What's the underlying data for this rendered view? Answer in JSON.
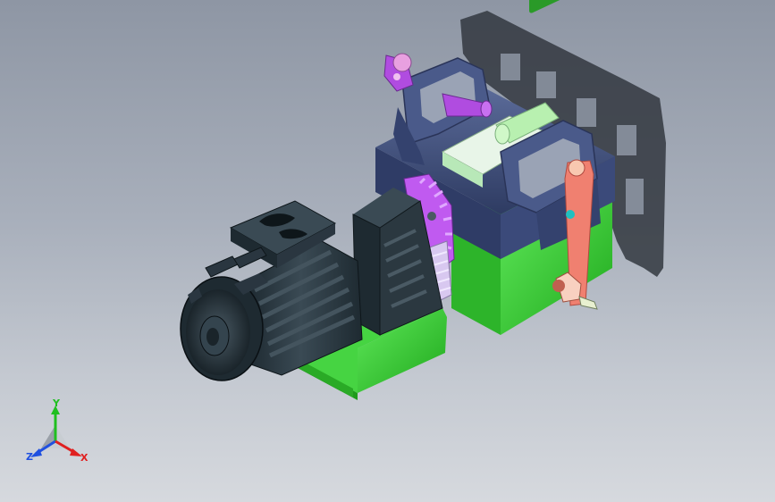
{
  "viewport": {
    "background_top": "#8e96a4",
    "background_bottom": "#d6d9de"
  },
  "model": {
    "parts": {
      "motor": "#2d3a42",
      "motor_housing": "#25323a",
      "gearbox": "#2b3840",
      "gear": "#c05af0",
      "rack": "#d8c8f0",
      "base_green": "#3fd23a",
      "frame_navy": "#3e4d7a",
      "purple_pin": "#b04ce0",
      "light_green_roller": "#b8f0b0",
      "salmon_lever": "#f08070",
      "shadow": "#3a3f48"
    }
  },
  "triad": {
    "y_label": "Y",
    "z_label": "Z",
    "x_label": "X",
    "y_color": "#1fbf1f",
    "z_color": "#2050e0",
    "x_color": "#e02020"
  }
}
